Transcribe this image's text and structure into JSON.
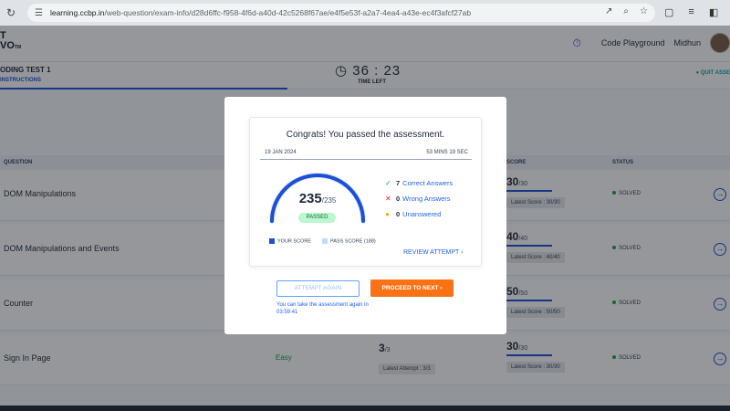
{
  "browser": {
    "url_domain": "learning.ccbp.in",
    "url_path": "/web-question/exam-info/d28d6ffc-f958-4f6d-a40d-42c5268f67ae/e4f5e53f-a2a7-4ea4-a43e-ec4f3afcf27ab"
  },
  "header": {
    "logo_line1": "T",
    "logo_line2": "VO",
    "logo_tm": "TM",
    "code_playground": "Code Playground",
    "user_name": "Midhun"
  },
  "test": {
    "title": "ODING TEST 1",
    "tab_instructions": "INSTRUCTIONS",
    "timer": "36 : 23",
    "timer_label": "TIME LEFT",
    "quit_label": "QUIT ASSE"
  },
  "table": {
    "headers": {
      "question": "QUESTION",
      "score": "SCORE",
      "status": "STATUS"
    },
    "rows": [
      {
        "name": "DOM Manipulations",
        "score": "30",
        "score_total": "/30",
        "latest": "Latest Score : 30/30",
        "status": "SOLVED"
      },
      {
        "name": "DOM Manipulations and Events",
        "score": "40",
        "score_total": "/40",
        "latest": "Latest Score : 40/40",
        "status": "SOLVED"
      },
      {
        "name": "Counter",
        "score": "50",
        "score_total": "/50",
        "latest": "Latest Score : 50/50",
        "status": "SOLVED"
      },
      {
        "name": "Sign In Page",
        "difficulty": "Easy",
        "attempt": "3",
        "attempt_total": "/3",
        "latest_attempt": "Latest Attempt : 3/3",
        "score": "30",
        "score_total": "/30",
        "latest": "Latest Score : 30/30",
        "status": "SOLVED"
      }
    ]
  },
  "modal": {
    "congrats": "Congrats! You passed the assessment.",
    "date": "19 JAN 2024",
    "duration": "53 MINS 19 SEC",
    "score": "235",
    "score_total": "/235",
    "passed": "PASSED",
    "correct_count": "7",
    "correct_label": "Correct Answers",
    "wrong_count": "0",
    "wrong_label": "Wrong Answers",
    "unanswered_count": "0",
    "unanswered_label": "Unanswered",
    "legend_your_score": "YOUR SCORE",
    "legend_pass_score": "PASS SCORE (188)",
    "review_label": "REVIEW ATTEMPT",
    "attempt_again": "ATTEMPT AGAIN",
    "proceed_next": "PROCEED TO NEXT",
    "again_note": "You can take the assessment again in 03:59:41",
    "score_fraction": 1.0
  },
  "colors": {
    "accent": "#1d4ed8",
    "orange": "#f97316",
    "success": "#16a34a"
  }
}
